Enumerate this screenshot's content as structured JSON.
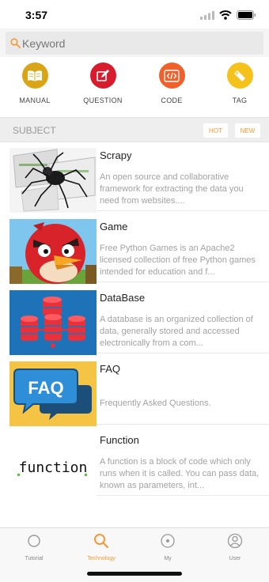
{
  "status": {
    "time": "3:57"
  },
  "search": {
    "placeholder": "Keyword",
    "value": ""
  },
  "quick_actions": [
    {
      "label": "MANUAL",
      "icon": "book-icon",
      "color": "#d9a416"
    },
    {
      "label": "QUESTION",
      "icon": "pencil-icon",
      "color": "#d71d2d"
    },
    {
      "label": "CODE",
      "icon": "code-icon",
      "color": "#f0602a"
    },
    {
      "label": "TAG",
      "icon": "tag-icon",
      "color": "#f5c11b"
    }
  ],
  "subject": {
    "title": "SUBJECT",
    "hot_label": "HOT",
    "new_label": "NEW"
  },
  "items": [
    {
      "title": "Scrapy",
      "description": "An open source and collaborative framework for extracting the data you need from websites...."
    },
    {
      "title": "Game",
      "description": "Free Python Games is an Apache2 licensed collection of free Python games intended for education and f..."
    },
    {
      "title": "DataBase",
      "description": "A database is an organized collection of data, generally stored and accessed electronically from a com..."
    },
    {
      "title": "FAQ",
      "description": "Frequently Asked Questions.",
      "thumb_text": "FAQ"
    },
    {
      "title": "Function",
      "description": "A function is a block of code which only runs when it is called. You can pass data, known as parameters, int...",
      "thumb_text": "function"
    }
  ],
  "tabs": [
    {
      "label": "Tutorial",
      "icon": "circle-icon"
    },
    {
      "label": "Technology",
      "icon": "search-icon",
      "active": true
    },
    {
      "label": "My",
      "icon": "target-icon"
    },
    {
      "label": "User",
      "icon": "user-icon"
    }
  ],
  "colors": {
    "accent": "#f39a37",
    "text_muted": "#a2a2a2"
  }
}
